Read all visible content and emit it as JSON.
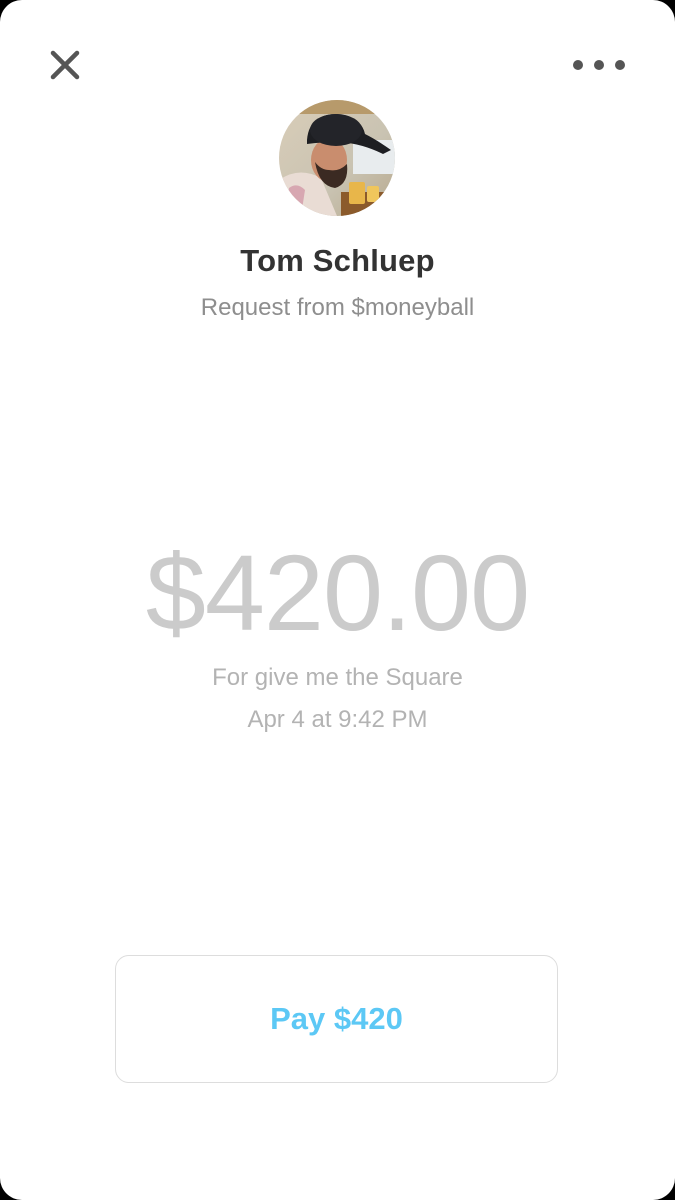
{
  "header": {
    "close_icon": "close-icon",
    "more_icon": "more-horizontal-icon"
  },
  "request": {
    "name": "Tom Schluep",
    "subtitle": "Request from $moneyball",
    "amount": "$420.00",
    "note": "For give me the Square",
    "date": "Apr 4 at 9:42 PM"
  },
  "actions": {
    "pay_label": "Pay $420"
  },
  "colors": {
    "background": "#ffffff",
    "name_text": "#333333",
    "secondary_text": "#8e8e8e",
    "amount_text": "#cbcbcb",
    "accent": "#5cc8f5",
    "button_border": "#dddddd"
  }
}
